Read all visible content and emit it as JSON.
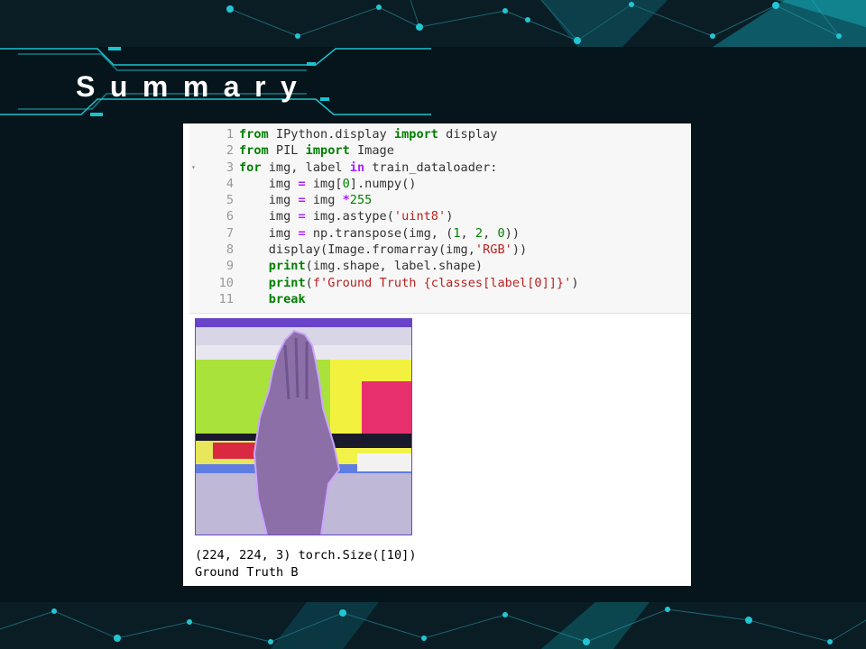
{
  "slide": {
    "title": "Summary",
    "background": "#06141b",
    "accent": "#19c3cf"
  },
  "code_cell": {
    "line_numbers": [
      "1",
      "2",
      "3",
      "4",
      "5",
      "6",
      "7",
      "8",
      "9",
      "10",
      "11"
    ],
    "fold_marker": "▾"
  },
  "output": {
    "image_alt": "hand sign image, false-colour",
    "text_lines": [
      "(224, 224, 3) torch.Size([10])",
      "Ground Truth B"
    ]
  }
}
